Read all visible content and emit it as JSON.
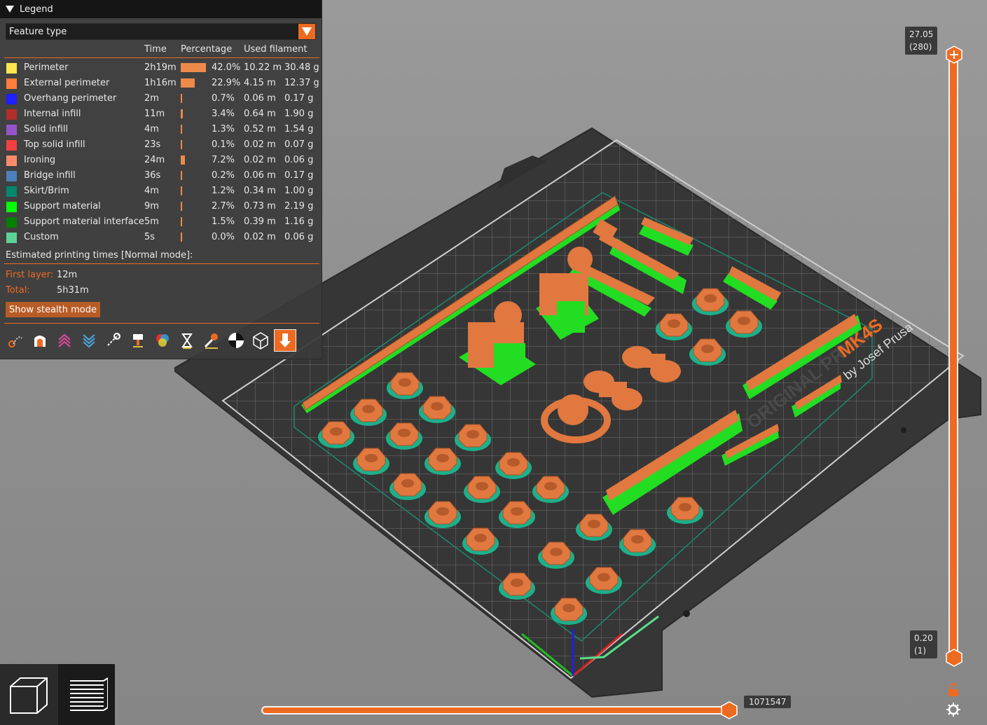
{
  "legend": {
    "title": "Legend",
    "view_type": "Feature type",
    "columns": {
      "time": "Time",
      "percentage": "Percentage",
      "used_filament": "Used filament"
    },
    "items": [
      {
        "name": "Perimeter",
        "color": "#FFE64D",
        "time": "2h19m",
        "percent": "42.0%",
        "fraction": 0.42,
        "length": "10.22 m",
        "weight": "30.48 g"
      },
      {
        "name": "External perimeter",
        "color": "#FF7D38",
        "time": "1h16m",
        "percent": "22.9%",
        "fraction": 0.229,
        "length": "4.15 m",
        "weight": "12.37 g"
      },
      {
        "name": "Overhang perimeter",
        "color": "#1F1FFF",
        "time": "2m",
        "percent": "0.7%",
        "fraction": 0.007,
        "length": "0.06 m",
        "weight": "0.17 g"
      },
      {
        "name": "Internal infill",
        "color": "#B03029",
        "time": "11m",
        "percent": "3.4%",
        "fraction": 0.034,
        "length": "0.64 m",
        "weight": "1.90 g"
      },
      {
        "name": "Solid infill",
        "color": "#9654CC",
        "time": "4m",
        "percent": "1.3%",
        "fraction": 0.013,
        "length": "0.52 m",
        "weight": "1.54 g"
      },
      {
        "name": "Top solid infill",
        "color": "#F04040",
        "time": "23s",
        "percent": "0.1%",
        "fraction": 0.001,
        "length": "0.02 m",
        "weight": "0.07 g"
      },
      {
        "name": "Ironing",
        "color": "#FF8C69",
        "time": "24m",
        "percent": "7.2%",
        "fraction": 0.072,
        "length": "0.02 m",
        "weight": "0.06 g"
      },
      {
        "name": "Bridge infill",
        "color": "#4D80BA",
        "time": "36s",
        "percent": "0.2%",
        "fraction": 0.002,
        "length": "0.06 m",
        "weight": "0.17 g"
      },
      {
        "name": "Skirt/Brim",
        "color": "#00876E",
        "time": "4m",
        "percent": "1.2%",
        "fraction": 0.012,
        "length": "0.34 m",
        "weight": "1.00 g"
      },
      {
        "name": "Support material",
        "color": "#00FF00",
        "time": "9m",
        "percent": "2.7%",
        "fraction": 0.027,
        "length": "0.73 m",
        "weight": "2.19 g"
      },
      {
        "name": "Support material interface",
        "color": "#008000",
        "time": "5m",
        "percent": "1.5%",
        "fraction": 0.015,
        "length": "0.39 m",
        "weight": "1.16 g"
      },
      {
        "name": "Custom",
        "color": "#5ED194",
        "time": "5s",
        "percent": "0.0%",
        "fraction": 0.0,
        "length": "0.02 m",
        "weight": "0.06 g"
      }
    ],
    "estimated_title": "Estimated printing times [Normal mode]:",
    "first_layer_label": "First layer:",
    "first_layer_value": "12m",
    "total_label": "Total:",
    "total_value": "5h31m",
    "stealth_button": "Show stealth mode",
    "toolbar_icons": [
      "travel-icon",
      "wipe-icon",
      "retractions-icon",
      "deretractions-icon",
      "seams-icon",
      "tool-changes-icon",
      "color-changes-icon",
      "pause-icon",
      "custom-gcode-icon",
      "center-of-gravity-icon",
      "shells-icon",
      "tool-marker-icon"
    ]
  },
  "vertical_slider": {
    "top_height": "27.05",
    "top_layer": "(280)",
    "bottom_height": "0.20",
    "bottom_layer": "(1)"
  },
  "horizontal_slider": {
    "value": "1071547"
  },
  "bed": {
    "brand_line1": "ORIGINAL PRUSA",
    "model": "MK4S",
    "brand_line2": "by Josef Prusa"
  },
  "colors": {
    "accent": "#ED6B21",
    "part": "#E07840",
    "support": "#22DD22",
    "bed": "#3b3b3b"
  },
  "view_buttons": {
    "left": "3d-view-icon",
    "right": "preview-layers-icon"
  }
}
